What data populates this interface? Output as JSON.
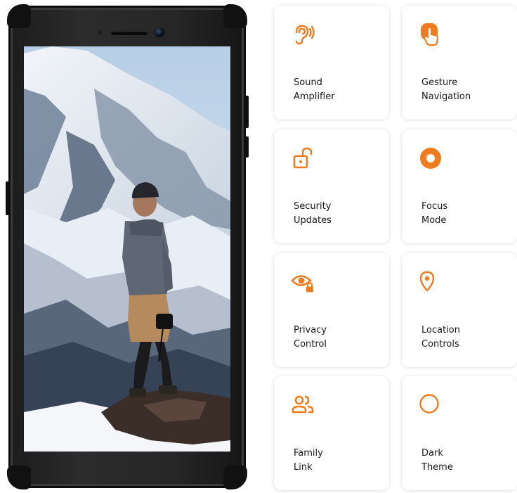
{
  "accent_color": "#f07c1e",
  "features": [
    {
      "icon": "ear-sound-icon",
      "line1": "Sound",
      "line2": "Amplifier"
    },
    {
      "icon": "hand-tap-icon",
      "line1": "Gesture",
      "line2": "Navigation"
    },
    {
      "icon": "unlock-icon",
      "line1": "Security",
      "line2": "Updates"
    },
    {
      "icon": "focus-dot-icon",
      "line1": "Focus",
      "line2": "Mode"
    },
    {
      "icon": "eye-lock-icon",
      "line1": "Privacy",
      "line2": "Control"
    },
    {
      "icon": "location-pin-icon",
      "line1": "Location",
      "line2": "Controls"
    },
    {
      "icon": "family-people-icon",
      "line1": "Family",
      "line2": "Link"
    },
    {
      "icon": "circle-outline-icon",
      "line1": "Dark",
      "line2": "Theme"
    }
  ]
}
